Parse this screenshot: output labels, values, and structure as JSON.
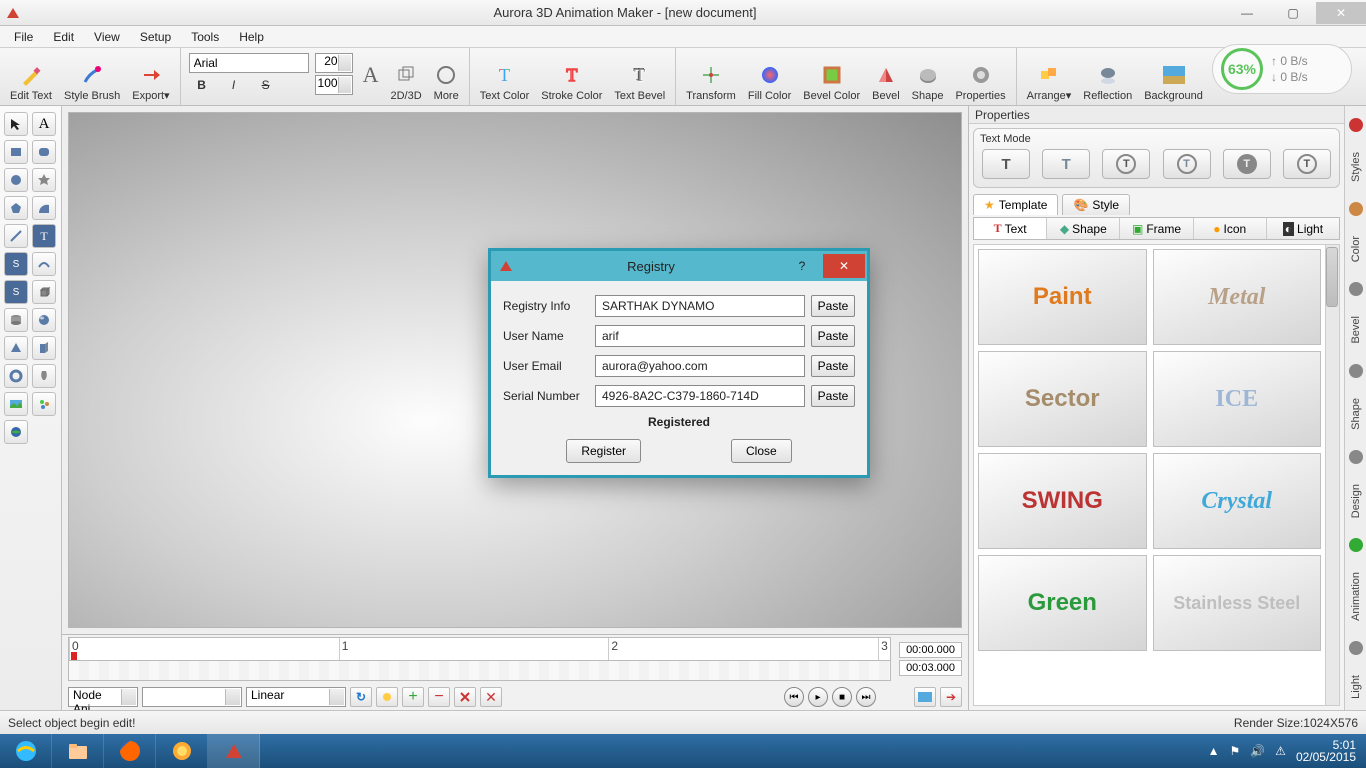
{
  "window": {
    "title": "Aurora 3D Animation Maker - [new document]"
  },
  "menu": [
    "File",
    "Edit",
    "View",
    "Setup",
    "Tools",
    "Help"
  ],
  "toolbar": {
    "edit_text": "Edit Text",
    "style_brush": "Style Brush",
    "export": "Export▾",
    "font_name": "Arial",
    "font_size_top": "20",
    "font_size_bottom": "100",
    "twod3d": "2D/3D",
    "more": "More",
    "text_color": "Text Color",
    "stroke_color": "Stroke Color",
    "text_bevel": "Text Bevel",
    "transform": "Transform",
    "fill_color": "Fill Color",
    "bevel_color": "Bevel Color",
    "bevel": "Bevel",
    "shape": "Shape",
    "properties": "Properties",
    "arrange": "Arrange▾",
    "reflection": "Reflection",
    "background": "Background"
  },
  "net": {
    "percent": "63%",
    "up": "↑ 0 B/s",
    "down": "↓ 0 B/s"
  },
  "timeline": {
    "ticks": [
      "0",
      "1",
      "2",
      "3"
    ],
    "t_start": "00:00.000",
    "t_end": "00:03.000",
    "combo1": "Node Ani",
    "combo2": "",
    "combo3": "Linear"
  },
  "right": {
    "header": "Properties",
    "text_mode": "Text Mode",
    "tabs": {
      "template": "Template",
      "style": "Style"
    },
    "subtabs": {
      "text": "Text",
      "shape": "Shape",
      "frame": "Frame",
      "icon": "Icon",
      "light": "Light"
    },
    "gallery": [
      "Paint",
      "Metal",
      "Sector",
      "ICE",
      "SWING",
      "Crystal",
      "Green",
      "Stainless Steel"
    ],
    "gallery_colors": [
      "#e07a1f",
      "#b9a189",
      "#a58c6a",
      "#9fb7d6",
      "#b33",
      "#3fa9d9",
      "#2a9a3c",
      "#bfbfbf"
    ],
    "side_tabs": [
      "Styles",
      "Color",
      "Bevel",
      "Shape",
      "Design",
      "Animation",
      "Light"
    ]
  },
  "status": {
    "left": "Select object begin edit!",
    "right": "Render Size:1024X576"
  },
  "dialog": {
    "title": "Registry",
    "rows": {
      "registry_info": {
        "label": "Registry Info",
        "value": "SARTHAK DYNAMO"
      },
      "user_name": {
        "label": "User Name",
        "value": "arif"
      },
      "user_email": {
        "label": "User Email",
        "value": "aurora@yahoo.com"
      },
      "serial": {
        "label": "Serial Number",
        "value": "4926-8A2C-C379-1860-714D"
      }
    },
    "paste": "Paste",
    "status": "Registered",
    "register": "Register",
    "close": "Close"
  },
  "taskbar": {
    "time": "5:01",
    "date": "02/05/2015"
  }
}
